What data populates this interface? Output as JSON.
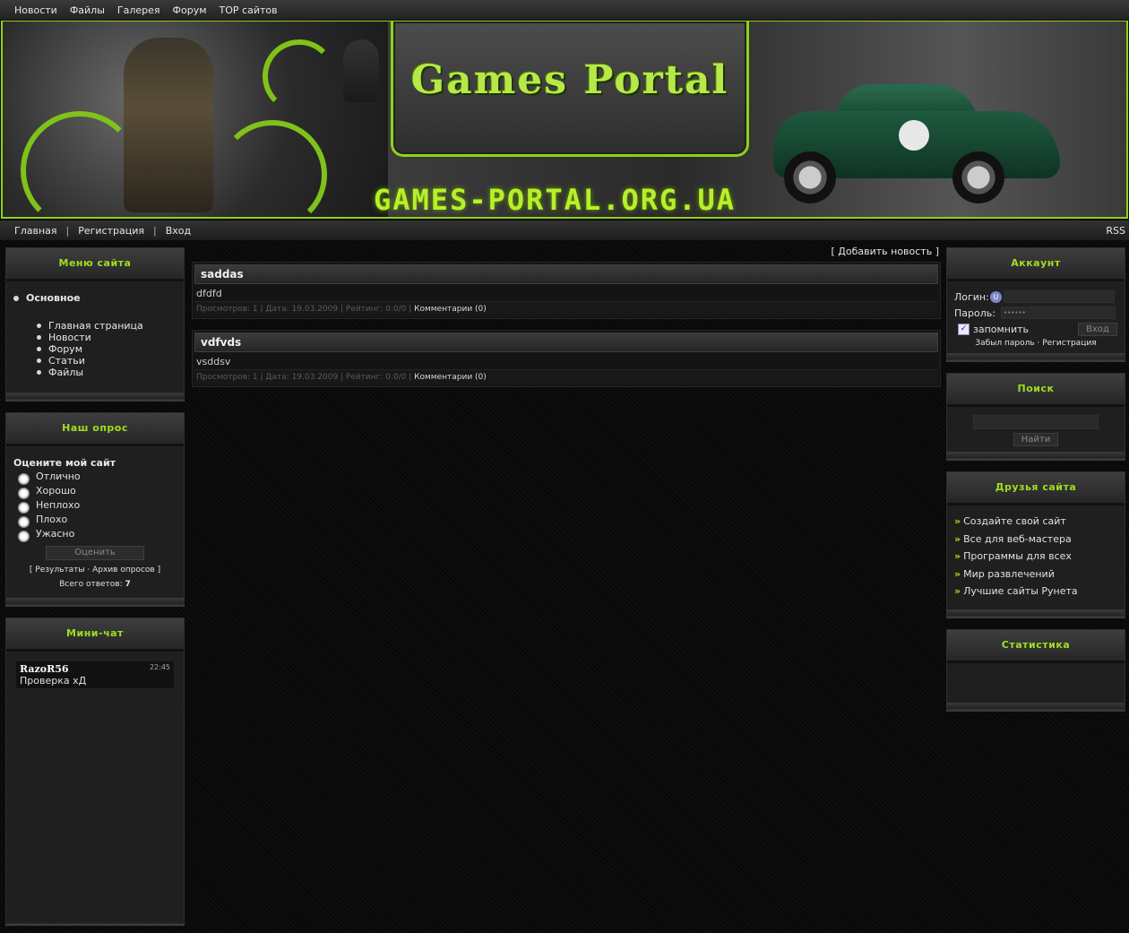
{
  "topnav": [
    "Новости",
    "Файлы",
    "Галерея",
    "Форум",
    "TOP сайтов"
  ],
  "header": {
    "logo": "Games Portal",
    "domain": "GAMES-PORTAL.ORG.UA"
  },
  "subnav": {
    "items": [
      "Главная",
      "Регистрация",
      "Вход"
    ],
    "rss": "RSS"
  },
  "left": {
    "menu": {
      "title": "Меню сайта",
      "category": "Основное",
      "items": [
        "Главная страница",
        "Новости",
        "Форум",
        "Статьи",
        "Файлы"
      ]
    },
    "poll": {
      "title": "Наш опрос",
      "question": "Оцените мой сайт",
      "options": [
        "Отлично",
        "Хорошо",
        "Неплохо",
        "Плохо",
        "Ужасно"
      ],
      "vote_button": "Оценить",
      "results_link": "Результаты",
      "archive_link": "Архив опросов",
      "total_label": "Всего ответов:",
      "total_value": "7"
    },
    "chat": {
      "title": "Мини-чат",
      "user": "RazoR56",
      "time": "22:45",
      "text": "Проверка хД"
    }
  },
  "content": {
    "add_news": "[ Добавить новость ]",
    "news": [
      {
        "title": "saddas",
        "body": "dfdfd",
        "meta": "Просмотров: 1 | Дата: 19.03.2009 | Рейтинг: 0.0/0 |",
        "comments": "Комментарии (0)"
      },
      {
        "title": "vdfvds",
        "body": "vsddsv",
        "meta": "Просмотров: 1 | Дата: 19.03.2009 | Рейтинг: 0.0/0 |",
        "comments": "Комментарии (0)"
      }
    ]
  },
  "right": {
    "account": {
      "title": "Аккаунт",
      "login_label": "Логин:",
      "password_label": "Пароль:",
      "password_mask": "••••••",
      "remember_label": "запомнить",
      "login_button": "Вход",
      "forgot_link": "Забыл пароль",
      "register_link": "Регистрация"
    },
    "search": {
      "title": "Поиск",
      "button": "Найти"
    },
    "friends": {
      "title": "Друзья сайта",
      "items": [
        "Создайте свой сайт",
        "Все для веб-мастера",
        "Программы для всех",
        "Мир развлечений",
        "Лучшие сайты Рунета"
      ]
    },
    "stats": {
      "title": "Статистика"
    }
  },
  "colors": {
    "accent": "#9fdf1f",
    "border": "#8fd11b",
    "background": "#0b0b0b"
  }
}
